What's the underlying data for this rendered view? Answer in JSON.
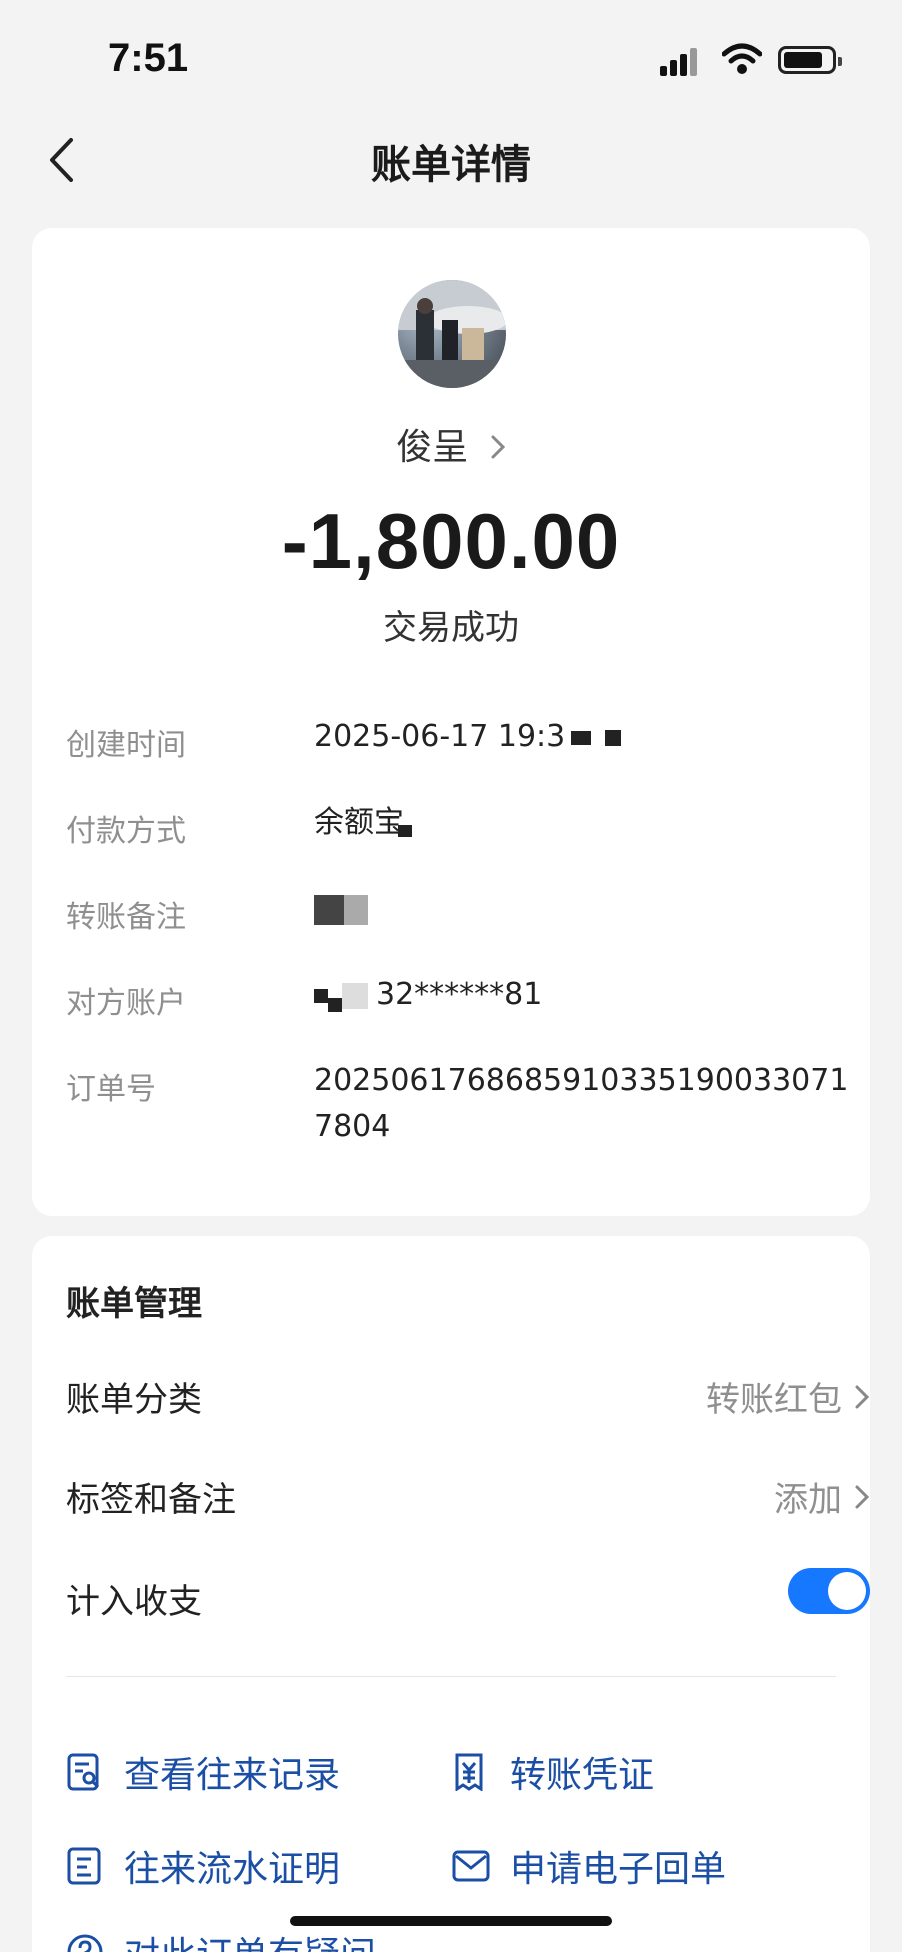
{
  "status_bar": {
    "time": "7:51"
  },
  "nav": {
    "title": "账单详情"
  },
  "payee": {
    "name": "俊呈",
    "amount": "-1,800.00",
    "status": "交易成功"
  },
  "details": [
    {
      "label": "创建时间",
      "value": "2025-06-17 19:3"
    },
    {
      "label": "付款方式",
      "value": "余额宝"
    },
    {
      "label": "转账备注",
      "value": ""
    },
    {
      "label": "对方账户",
      "value": "32******81"
    },
    {
      "label": "订单号",
      "value": "2025061768685910335190033071 7804"
    }
  ],
  "management": {
    "title": "账单管理",
    "category_label": "账单分类",
    "category_value": "转账红包",
    "tags_label": "标签和备注",
    "tags_value": "添加",
    "include_label": "计入收支",
    "include_on": true
  },
  "links": {
    "history": "查看往来记录",
    "voucher": "转账凭证",
    "statement": "往来流水证明",
    "receipt": "申请电子回单",
    "question": "对此订单有疑问"
  },
  "colors": {
    "accent": "#1677ff",
    "link": "#1b4fa6"
  }
}
